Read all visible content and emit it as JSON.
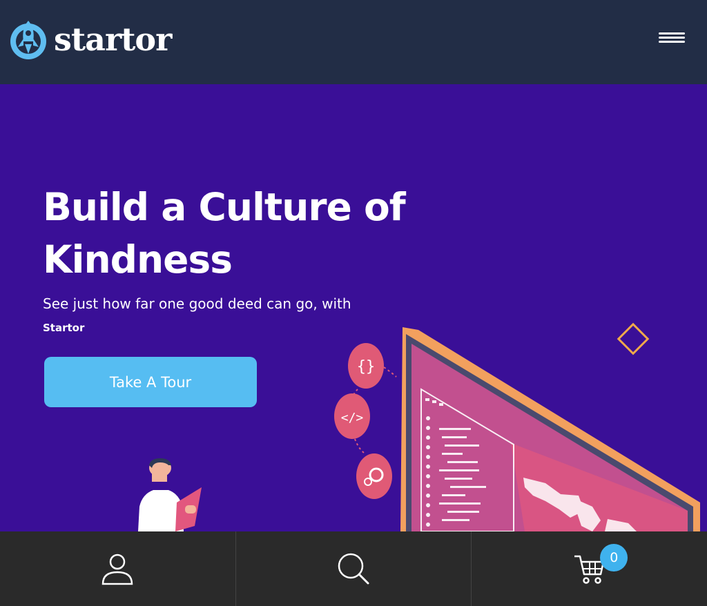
{
  "brand": {
    "name": "startor",
    "logo_icon": "rocket-icon",
    "accent": "#56bdf2",
    "header_bg": "#222d46",
    "hero_bg": "#3a0f97"
  },
  "header": {
    "menu_icon": "hamburger-menu-icon"
  },
  "hero": {
    "title_line1": "Build a Culture of",
    "title_line2": "Kindness",
    "subtitle": "See just how far one good deed can go, with",
    "brand_mention": "Startor",
    "cta_label": "Take A Tour",
    "illustration_icons": [
      "code-braces-icon",
      "code-slash-icon",
      "gear-icon"
    ]
  },
  "bottom_nav": {
    "items": [
      {
        "icon": "user-icon"
      },
      {
        "icon": "search-icon"
      },
      {
        "icon": "cart-icon",
        "badge": "0"
      }
    ]
  }
}
